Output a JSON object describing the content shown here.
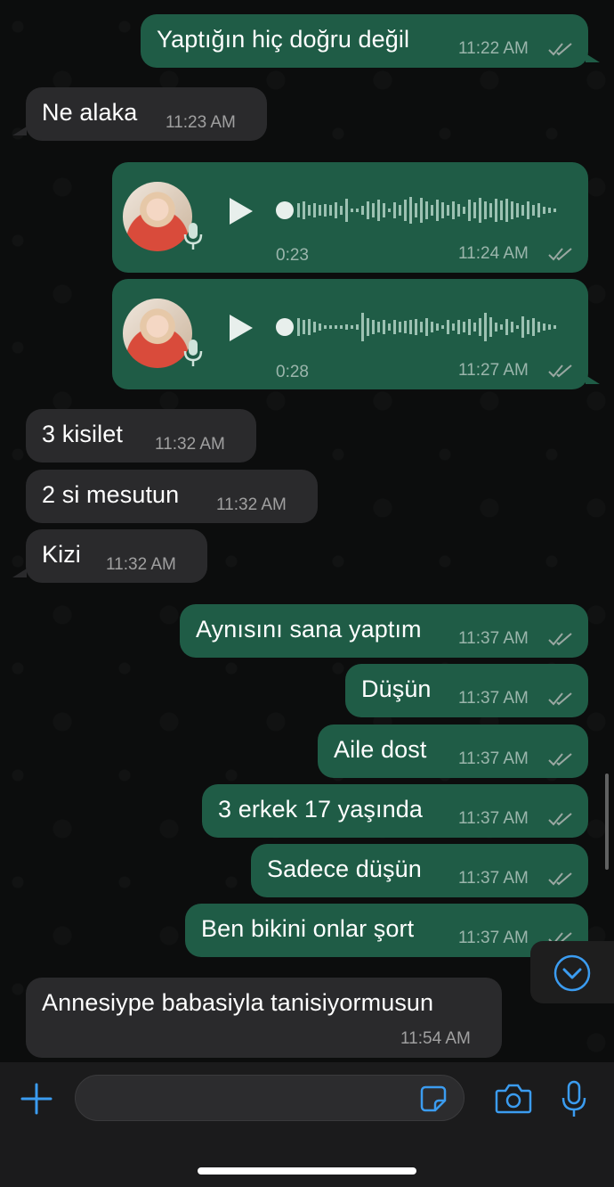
{
  "messages": [
    {
      "type": "text",
      "dir": "out",
      "text": "Yaptığın hiç doğru değil",
      "time": "11:22 AM",
      "read": true
    },
    {
      "type": "text",
      "dir": "in",
      "text": "Ne alaka",
      "time": "11:23 AM"
    },
    {
      "type": "voice",
      "dir": "out",
      "duration": "0:23",
      "time": "11:24 AM",
      "read": true
    },
    {
      "type": "voice",
      "dir": "out",
      "duration": "0:28",
      "time": "11:27 AM",
      "read": true
    },
    {
      "type": "text",
      "dir": "in",
      "text": "3 kisilet",
      "time": "11:32 AM"
    },
    {
      "type": "text",
      "dir": "in",
      "text": "2 si mesutun",
      "time": "11:32 AM"
    },
    {
      "type": "text",
      "dir": "in",
      "text": "Kizi",
      "time": "11:32 AM"
    },
    {
      "type": "text",
      "dir": "out",
      "text": "Aynısını sana yaptım",
      "time": "11:37 AM",
      "read": true
    },
    {
      "type": "text",
      "dir": "out",
      "text": "Düşün",
      "time": "11:37 AM",
      "read": true
    },
    {
      "type": "text",
      "dir": "out",
      "text": "Aile dost",
      "time": "11:37 AM",
      "read": true
    },
    {
      "type": "text",
      "dir": "out",
      "text": "3 erkek 17 yaşında",
      "time": "11:37 AM",
      "read": true
    },
    {
      "type": "text",
      "dir": "out",
      "text": "Sadece düşün",
      "time": "11:37 AM",
      "read": true
    },
    {
      "type": "text",
      "dir": "out",
      "text": "Ben bikini onlar şort",
      "time": "11:37 AM",
      "read": true
    },
    {
      "type": "text",
      "dir": "in",
      "text": "Annesiype babasiyla tanisiyormusun",
      "time": "11:54 AM"
    }
  ],
  "composer": {
    "placeholder": "",
    "icons": [
      "plus-icon",
      "sticker-icon",
      "camera-icon",
      "microphone-icon"
    ]
  },
  "colors": {
    "outgoing_bubble": "#1f5c46",
    "incoming_bubble": "#2a2a2c",
    "accent": "#3b9cf0",
    "read_ticks": "#9aa8a2"
  }
}
